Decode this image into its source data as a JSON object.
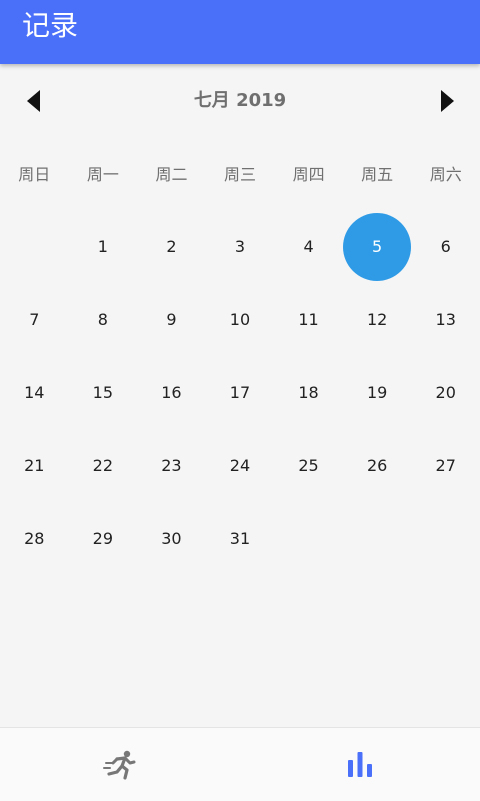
{
  "app_bar": {
    "title": "记录",
    "background": "#4a70f9"
  },
  "calendar": {
    "month_label": "七月 2019",
    "prev_icon": "triangle-left-icon",
    "next_icon": "triangle-right-icon",
    "weekdays": [
      "周日",
      "周一",
      "周二",
      "周三",
      "周四",
      "周五",
      "周六"
    ],
    "weeks": [
      [
        "",
        "1",
        "2",
        "3",
        "4",
        "5",
        "6"
      ],
      [
        "7",
        "8",
        "9",
        "10",
        "11",
        "12",
        "13"
      ],
      [
        "14",
        "15",
        "16",
        "17",
        "18",
        "19",
        "20"
      ],
      [
        "21",
        "22",
        "23",
        "24",
        "25",
        "26",
        "27"
      ],
      [
        "28",
        "29",
        "30",
        "31",
        "",
        "",
        ""
      ]
    ],
    "selected_day": "5",
    "selected_color": "#2f9be6"
  },
  "bottom_nav": {
    "items": [
      {
        "icon": "running-icon",
        "active": false,
        "color": "#777777"
      },
      {
        "icon": "bar-chart-icon",
        "active": true,
        "color": "#4a70f9"
      }
    ]
  }
}
